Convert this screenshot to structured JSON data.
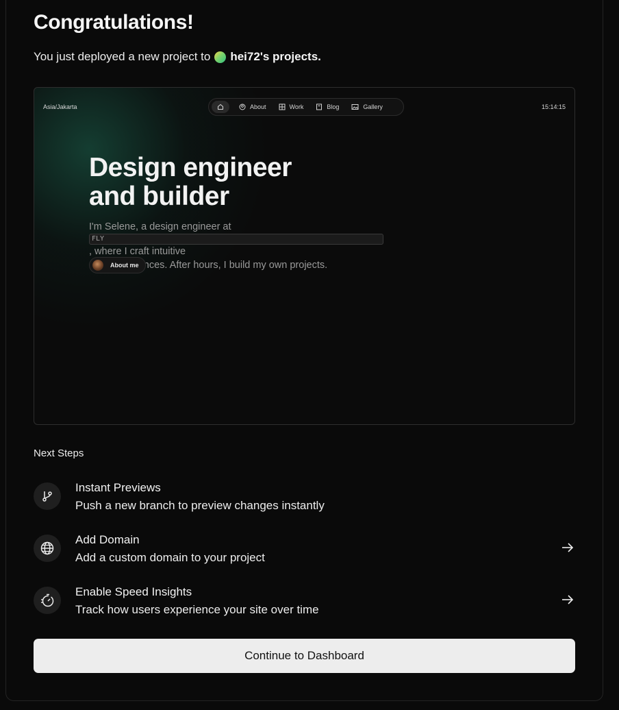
{
  "header": {
    "title": "Congratulations!",
    "subtitle_prefix": "You just deployed a new project to",
    "team_name": "hei72's projects."
  },
  "preview": {
    "timezone": "Asia/Jakarta",
    "time": "15:14:15",
    "nav": [
      {
        "label": "About",
        "icon": "user-circle-icon"
      },
      {
        "label": "Work",
        "icon": "grid-icon"
      },
      {
        "label": "Blog",
        "icon": "book-icon"
      },
      {
        "label": "Gallery",
        "icon": "image-icon"
      }
    ],
    "heading_line1": "Design engineer",
    "heading_line2": "and builder",
    "body_line1_before": "I'm Selene, a design engineer at",
    "body_tag": "FLY",
    "body_line1_after": ", where I craft intuitive",
    "body_line2": "user experiences. After hours, I build my own projects.",
    "button_label": "About me",
    "accent_gradient": "#164638"
  },
  "next_steps": {
    "title": "Next Steps",
    "items": [
      {
        "title": "Instant Previews",
        "description": "Push a new branch to preview changes instantly",
        "icon": "git-branch-icon",
        "has_arrow": false
      },
      {
        "title": "Add Domain",
        "description": "Add a custom domain to your project",
        "icon": "globe-icon",
        "has_arrow": true
      },
      {
        "title": "Enable Speed Insights",
        "description": "Track how users experience your site over time",
        "icon": "speed-gauge-icon",
        "has_arrow": true
      }
    ]
  },
  "actions": {
    "continue_label": "Continue to Dashboard"
  }
}
